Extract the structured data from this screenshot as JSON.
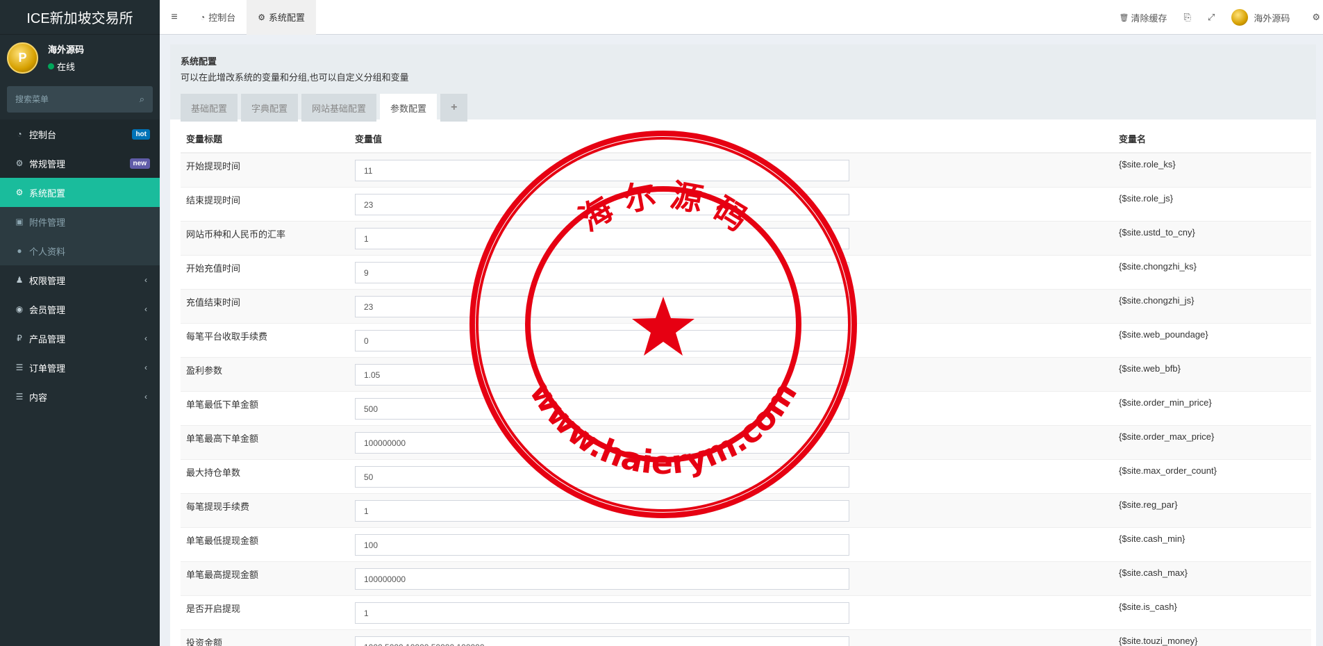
{
  "app": {
    "title": "ICE新加坡交易所"
  },
  "user": {
    "name": "海外源码",
    "status": "在线",
    "avatar_letter": "P"
  },
  "search": {
    "placeholder": "搜索菜单"
  },
  "menu": [
    {
      "icon": "dashboard-icon",
      "glyph": "◔",
      "label": "控制台",
      "badge": "hot"
    },
    {
      "icon": "cogs-icon",
      "glyph": "⚙",
      "label": "常规管理",
      "badge": "new"
    },
    {
      "icon": "gear-icon",
      "glyph": "⚙",
      "label": "系统配置"
    },
    {
      "icon": "image-icon",
      "glyph": "▣",
      "label": "附件管理"
    },
    {
      "icon": "user-icon",
      "glyph": "●",
      "label": "个人资料"
    },
    {
      "icon": "group-icon",
      "glyph": "♟",
      "label": "权限管理"
    },
    {
      "icon": "user-circle-icon",
      "glyph": "◉",
      "label": "会员管理"
    },
    {
      "icon": "ruble-icon",
      "glyph": "₽",
      "label": "产品管理"
    },
    {
      "icon": "list-icon",
      "glyph": "☰",
      "label": "订单管理"
    },
    {
      "icon": "list-icon",
      "glyph": "☰",
      "label": "内容"
    }
  ],
  "header": {
    "tabs": [
      {
        "label": "控制台"
      },
      {
        "label": "系统配置"
      }
    ],
    "clear_cache": "清除缓存",
    "user_name": "海外源码"
  },
  "panel": {
    "title": "系统配置",
    "description": "可以在此增改系统的变量和分组,也可以自定义分组和变量",
    "tabs": [
      "基础配置",
      "字典配置",
      "网站基础配置",
      "参数配置",
      "+"
    ]
  },
  "table": {
    "headers": {
      "title": "变量标题",
      "value": "变量值",
      "name": "变量名"
    },
    "rows": [
      {
        "title": "开始提现时间",
        "value": "11",
        "name": "{$site.role_ks}"
      },
      {
        "title": "结束提现时间",
        "value": "23",
        "name": "{$site.role_js}"
      },
      {
        "title": "网站币种和人民币的汇率",
        "value": "1",
        "name": "{$site.ustd_to_cny}"
      },
      {
        "title": "开始充值时间",
        "value": "9",
        "name": "{$site.chongzhi_ks}"
      },
      {
        "title": "充值结束时间",
        "value": "23",
        "name": "{$site.chongzhi_js}"
      },
      {
        "title": "每笔平台收取手续费",
        "value": "0",
        "name": "{$site.web_poundage}"
      },
      {
        "title": "盈利参数",
        "value": "1.05",
        "name": "{$site.web_bfb}"
      },
      {
        "title": "单笔最低下单金额",
        "value": "500",
        "name": "{$site.order_min_price}"
      },
      {
        "title": "单笔最高下单金额",
        "value": "100000000",
        "name": "{$site.order_max_price}"
      },
      {
        "title": "最大持仓单数",
        "value": "50",
        "name": "{$site.max_order_count}"
      },
      {
        "title": "每笔提现手续费",
        "value": "1",
        "name": "{$site.reg_par}"
      },
      {
        "title": "单笔最低提现金额",
        "value": "100",
        "name": "{$site.cash_min}"
      },
      {
        "title": "单笔最高提现金额",
        "value": "100000000",
        "name": "{$site.cash_max}"
      },
      {
        "title": "是否开启提现",
        "value": "1",
        "name": "{$site.is_cash}"
      },
      {
        "title": "投资金额",
        "value": "1000,5000,10000,50000,100000",
        "name": "{$site.touzi_money}"
      }
    ]
  },
  "watermark": {
    "top_text": "海 尔 源 码",
    "bottom_text": "www.haierym.com",
    "color": "#e60012"
  }
}
